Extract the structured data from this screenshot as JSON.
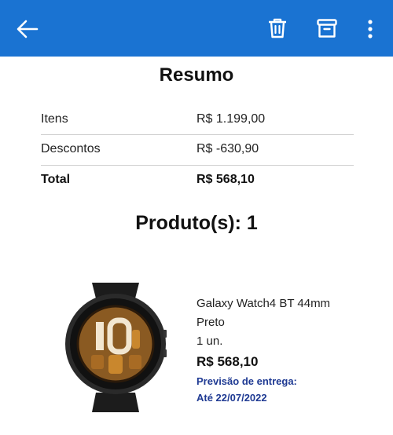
{
  "header": {
    "background": "#1a73d2",
    "icons": [
      "back-arrow-icon",
      "trash-icon",
      "archive-icon",
      "more-vertical-icon"
    ]
  },
  "summary": {
    "title": "Resumo",
    "rows": [
      {
        "label": "Itens",
        "value": "R$ 1.199,00"
      },
      {
        "label": "Descontos",
        "value": "R$ -630,90"
      },
      {
        "label": "Total",
        "value": "R$ 568,10"
      }
    ]
  },
  "products": {
    "title": "Produto(s): 1",
    "items": [
      {
        "name": "Galaxy Watch4 BT 44mm",
        "color": "Preto",
        "quantity": "1 un.",
        "price": "R$ 568,10",
        "delivery_label": "Previsão de entrega:",
        "delivery_date": "Até 22/07/2022"
      }
    ]
  },
  "colors": {
    "accent": "#1a73d2",
    "delivery_text": "#1f3a93"
  }
}
